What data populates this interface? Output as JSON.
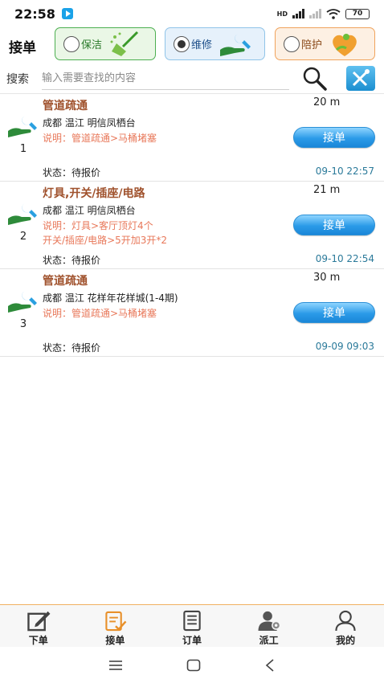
{
  "status_bar": {
    "time": "22:58",
    "network_label": "HD",
    "battery": "70"
  },
  "header": {
    "title": "接单",
    "categories": [
      {
        "label": "保洁",
        "selected": false
      },
      {
        "label": "维修",
        "selected": true
      },
      {
        "label": "陪护",
        "selected": false
      }
    ]
  },
  "search": {
    "label": "搜索",
    "placeholder": "输入需要查找的内容"
  },
  "orders": [
    {
      "num": "1",
      "title": "管道疏通",
      "distance": "20 m",
      "address": "成都 温江 明信凤栖台",
      "desc_lines": [
        "说明：管道疏通>马桶堵塞"
      ],
      "accept_label": "接单",
      "status": "状态：待报价",
      "time": "09-10 22:57"
    },
    {
      "num": "2",
      "title": "灯具,开关/插座/电路",
      "distance": "21 m",
      "address": "成都 温江 明信凤栖台",
      "desc_lines": [
        "说明：灯具>客厅顶灯4个",
        "开关/插座/电路>5开加3开*2"
      ],
      "accept_label": "接单",
      "status": "状态：待报价",
      "time": "09-10 22:54"
    },
    {
      "num": "3",
      "title": "管道疏通",
      "distance": "30 m",
      "address": "成都 温江 花样年花样城(1-4期)",
      "desc_lines": [
        "说明：管道疏通>马桶堵塞"
      ],
      "accept_label": "接单",
      "status": "状态：待报价",
      "time": "09-09 09:03"
    }
  ],
  "bottom_nav": [
    {
      "label": "下单",
      "icon": "edit-icon"
    },
    {
      "label": "接单",
      "icon": "accept-order-icon"
    },
    {
      "label": "订单",
      "icon": "orders-icon"
    },
    {
      "label": "派工",
      "icon": "dispatch-icon"
    },
    {
      "label": "我的",
      "icon": "profile-icon"
    }
  ],
  "colors": {
    "accent_blue": "#2b9be8",
    "title_brown": "#a0522d",
    "desc_orange": "#e8785a",
    "time_teal": "#2b7a9a",
    "nav_border": "#f0b060"
  }
}
